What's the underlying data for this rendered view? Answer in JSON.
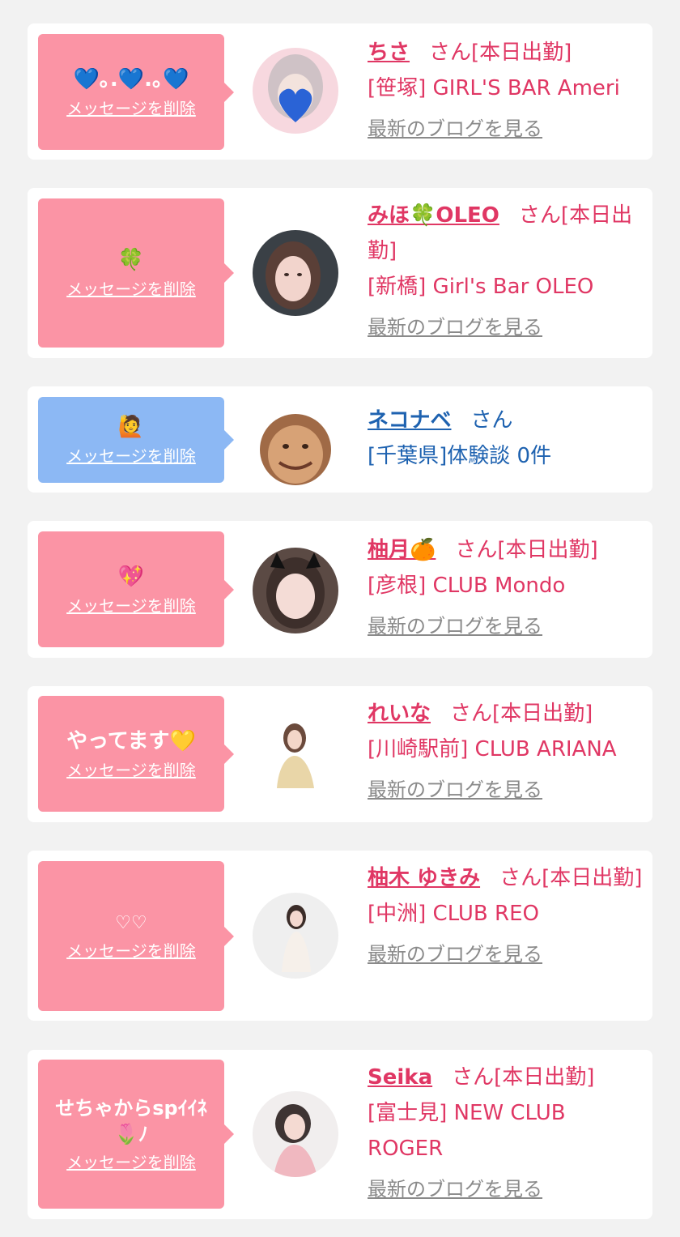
{
  "delete_label": "メッセージを削除",
  "blog_label": "最新のブログを見る",
  "cards": [
    {
      "message": "💙｡.💙.｡💙",
      "name": "ちさ",
      "suffix": "さん[本日出勤]",
      "shop": "[笹塚] GIRL'S BAR Ameri"
    },
    {
      "message": "🍀",
      "name": "みほ🍀OLEO",
      "suffix": "さん[本日出勤]",
      "shop": "[新橋] Girl's Bar OLEO"
    },
    {
      "message": "🙋",
      "name": "ネコナベ",
      "suffix": "さん",
      "shop": "[千葉県]体験談 0件"
    },
    {
      "message": "💖",
      "name": "柚月🍊",
      "suffix": "さん[本日出勤]",
      "shop": "[彦根] CLUB Mondo"
    },
    {
      "message": "やってます💛",
      "name": "れいな",
      "suffix": "さん[本日出勤]",
      "shop": "[川崎駅前] CLUB ARIANA"
    },
    {
      "message": "♡♡",
      "name": "柚木 ゆきみ",
      "suffix": "さん[本日出勤]",
      "shop": "[中洲] CLUB REO"
    },
    {
      "message": "せちゃからspｲｲﾈ🌷ﾉ",
      "name": "Seika",
      "suffix": "さん[本日出勤]",
      "shop": "[富士見] NEW CLUB ROGER"
    }
  ],
  "colors": {
    "pink_bubble": "#fb94a5",
    "blue_bubble": "#8cb8f4",
    "name_pink": "#e03764",
    "name_blue": "#1e62b0"
  }
}
